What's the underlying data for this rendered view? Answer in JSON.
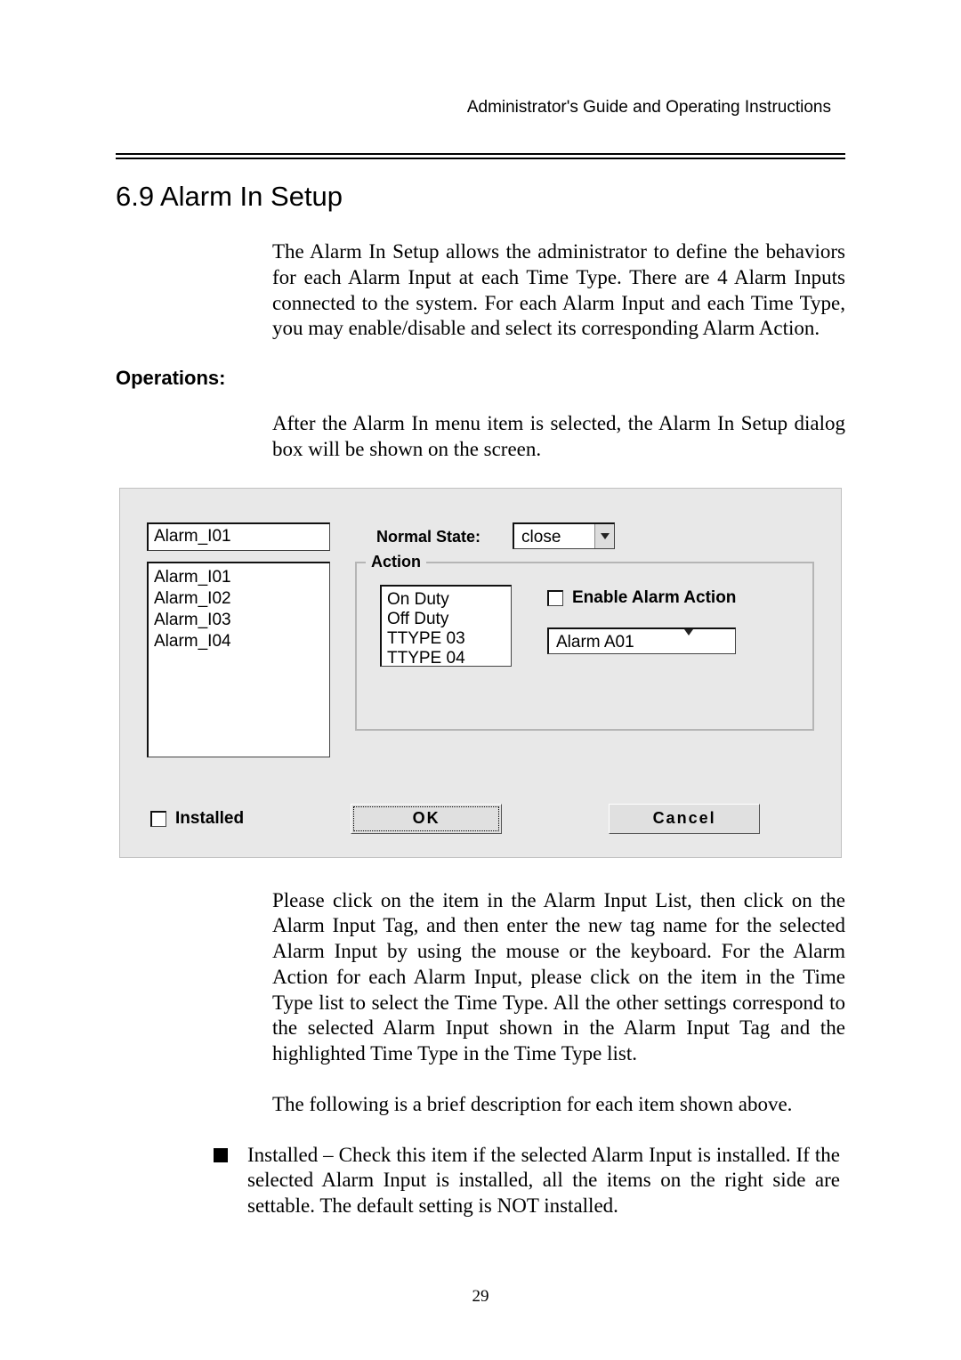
{
  "header": "Administrator's Guide and Operating Instructions",
  "section_title": "6.9 Alarm In Setup",
  "paragraph_intro": "The Alarm In Setup allows the administrator to define the behaviors for each Alarm Input at each Time Type.    There are 4 Alarm Inputs connected to the system.    For each Alarm Input and each Time Type, you may enable/disable and select its corresponding Alarm Action.",
  "operations_heading": "Operations:",
  "paragraph_after_ops": "After the Alarm In menu item is selected, the Alarm In Setup dialog box will be shown on the screen.",
  "dialog": {
    "tag_value": "Alarm_I01",
    "normal_state_label": "Normal State:",
    "normal_state_value": "close",
    "input_list": [
      "Alarm_I01",
      "Alarm_I02",
      "Alarm_I03",
      "Alarm_I04"
    ],
    "action_group_label": "Action",
    "time_type_list": [
      "On Duty",
      "Off Duty",
      "TTYPE 03",
      "TTYPE 04"
    ],
    "enable_label": "Enable Alarm Action",
    "alarm_action_value": "Alarm A01",
    "installed_label": "Installed",
    "ok_label": "OK",
    "cancel_label": "Cancel"
  },
  "paragraph_after_dialog": "Please click on the item in the Alarm Input List, then click on the Alarm Input Tag, and then enter the new tag name for the selected Alarm Input by using the mouse or the keyboard.    For the Alarm Action for each Alarm Input, please click on the item in the Time Type list to select the Time Type.    All the other settings correspond to the selected Alarm Input shown in the Alarm Input Tag and the highlighted Time Type in the Time Type list.",
  "paragraph_following": "The following is a brief description for each item shown above.",
  "bullet_text": "Installed – Check this item if the selected Alarm Input is installed. If the selected Alarm Input is installed, all the items on the right side are settable.    The default setting is NOT installed.",
  "page_number": "29"
}
